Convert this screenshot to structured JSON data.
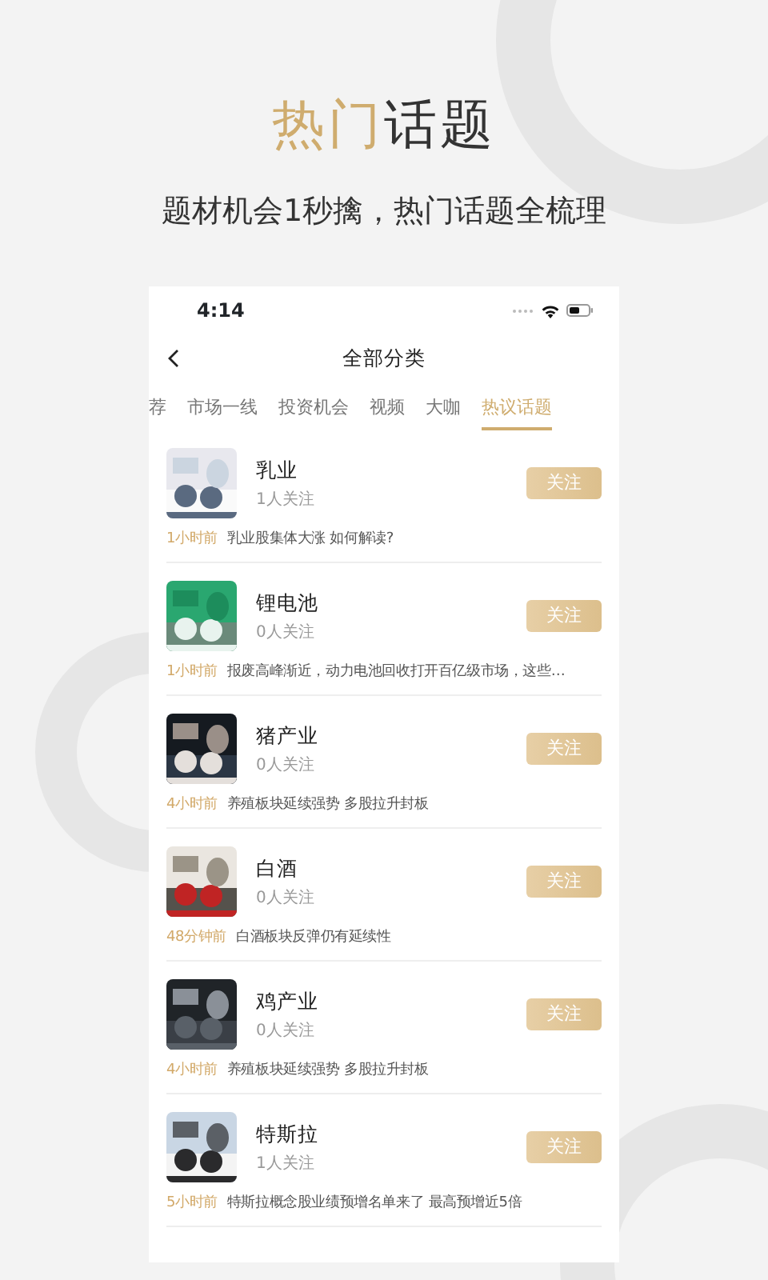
{
  "headline": {
    "accent": "热门",
    "rest": "话题"
  },
  "subtitle": "题材机会1秒擒，热门话题全梳理",
  "status_bar": {
    "time": "4:14"
  },
  "nav": {
    "title": "全部分类"
  },
  "tabs": [
    {
      "label": "荐",
      "selected": false
    },
    {
      "label": "市场一线",
      "selected": false
    },
    {
      "label": "投资机会",
      "selected": false
    },
    {
      "label": "视频",
      "selected": false
    },
    {
      "label": "大咖",
      "selected": false
    },
    {
      "label": "热议话题",
      "selected": true
    }
  ],
  "topics": [
    {
      "name": "乳业",
      "followers": "1人关注",
      "button": "关注",
      "time": "1小时前",
      "headline": "乳业股集体大涨 如何解读?"
    },
    {
      "name": "锂电池",
      "followers": "0人关注",
      "button": "关注",
      "time": "1小时前",
      "headline": "报废高峰渐近，动力电池回收打开百亿级市场，这些…"
    },
    {
      "name": "猪产业",
      "followers": "0人关注",
      "button": "关注",
      "time": "4小时前",
      "headline": "养殖板块延续强势 多股拉升封板"
    },
    {
      "name": "白酒",
      "followers": "0人关注",
      "button": "关注",
      "time": "48分钟前",
      "headline": "白酒板块反弹仍有延续性"
    },
    {
      "name": "鸡产业",
      "followers": "0人关注",
      "button": "关注",
      "time": "4小时前",
      "headline": "养殖板块延续强势 多股拉升封板"
    },
    {
      "name": "特斯拉",
      "followers": "1人关注",
      "button": "关注",
      "time": "5小时前",
      "headline": "特斯拉概念股业绩预增名单来了 最高预增近5倍"
    }
  ]
}
